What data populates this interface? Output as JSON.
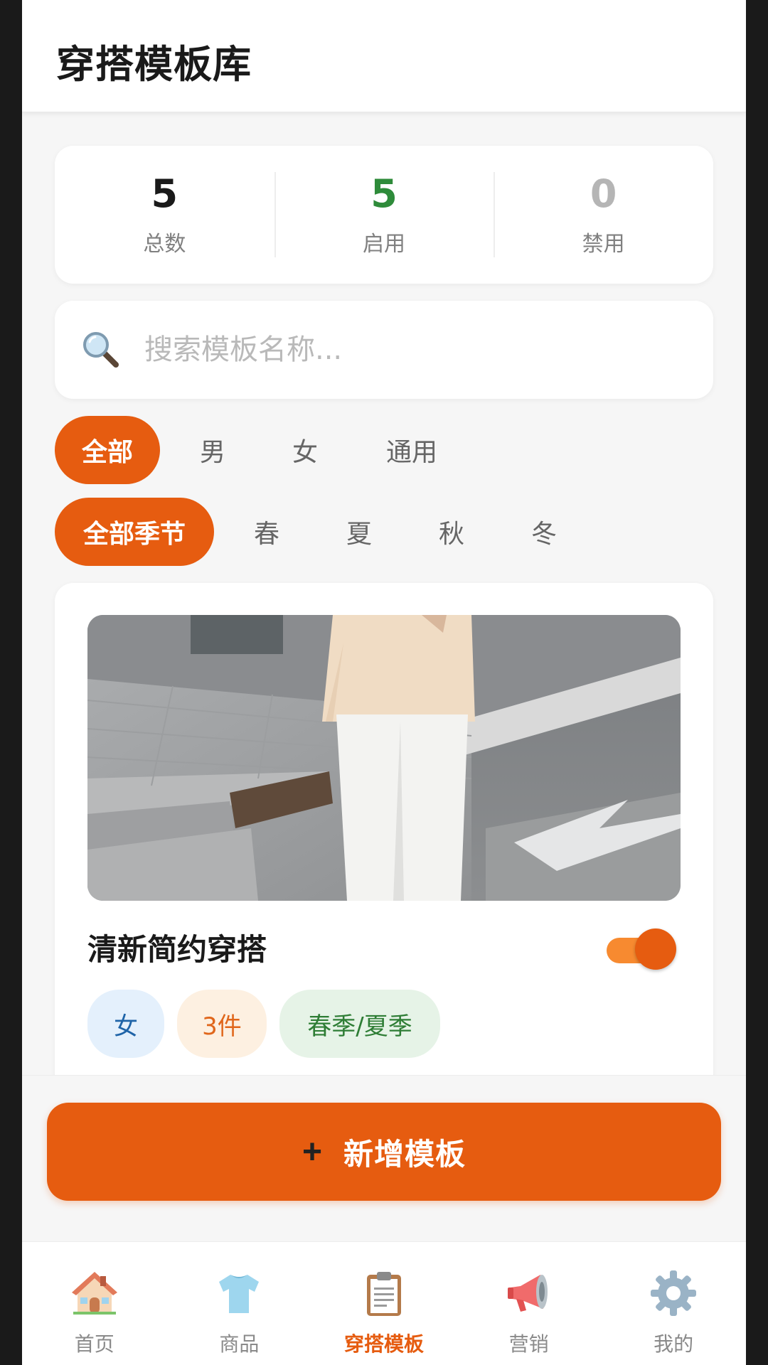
{
  "header": {
    "title": "穿搭模板库"
  },
  "stats": [
    {
      "value": "5",
      "label": "总数",
      "color": "#1a1a1a"
    },
    {
      "value": "5",
      "label": "启用",
      "color": "#2e8b3a"
    },
    {
      "value": "0",
      "label": "禁用",
      "color": "#b5b5b5"
    }
  ],
  "search": {
    "placeholder": "搜索模板名称...",
    "value": "",
    "icon": "search-icon"
  },
  "gender_filters": [
    {
      "label": "全部",
      "active": true
    },
    {
      "label": "男",
      "active": false
    },
    {
      "label": "女",
      "active": false
    },
    {
      "label": "通用",
      "active": false
    }
  ],
  "season_filters": [
    {
      "label": "全部季节",
      "active": true
    },
    {
      "label": "春",
      "active": false
    },
    {
      "label": "夏",
      "active": false
    },
    {
      "label": "秋",
      "active": false
    },
    {
      "label": "冬",
      "active": false
    }
  ],
  "templates": [
    {
      "title": "清新简约穿搭",
      "enabled": true,
      "tags": [
        {
          "text": "女",
          "bg": "#e4f0fc",
          "color": "#1f64a8"
        },
        {
          "text": "3件",
          "bg": "#fdf0e1",
          "color": "#e0661b"
        },
        {
          "text": "春季/夏季",
          "bg": "#e6f3e7",
          "color": "#2e7d35"
        }
      ]
    }
  ],
  "add_button": {
    "plus": "+",
    "label": "新增模板"
  },
  "bottom_nav": [
    {
      "label": "首页",
      "icon": "house-icon",
      "active": false
    },
    {
      "label": "商品",
      "icon": "tshirt-icon",
      "active": false
    },
    {
      "label": "穿搭模板",
      "icon": "clipboard-icon",
      "active": true
    },
    {
      "label": "营销",
      "icon": "megaphone-icon",
      "active": false
    },
    {
      "label": "我的",
      "icon": "gear-icon",
      "active": false
    }
  ],
  "colors": {
    "accent": "#e65c10",
    "enabled_green": "#2e8b3a",
    "disabled_gray": "#b5b5b5"
  }
}
